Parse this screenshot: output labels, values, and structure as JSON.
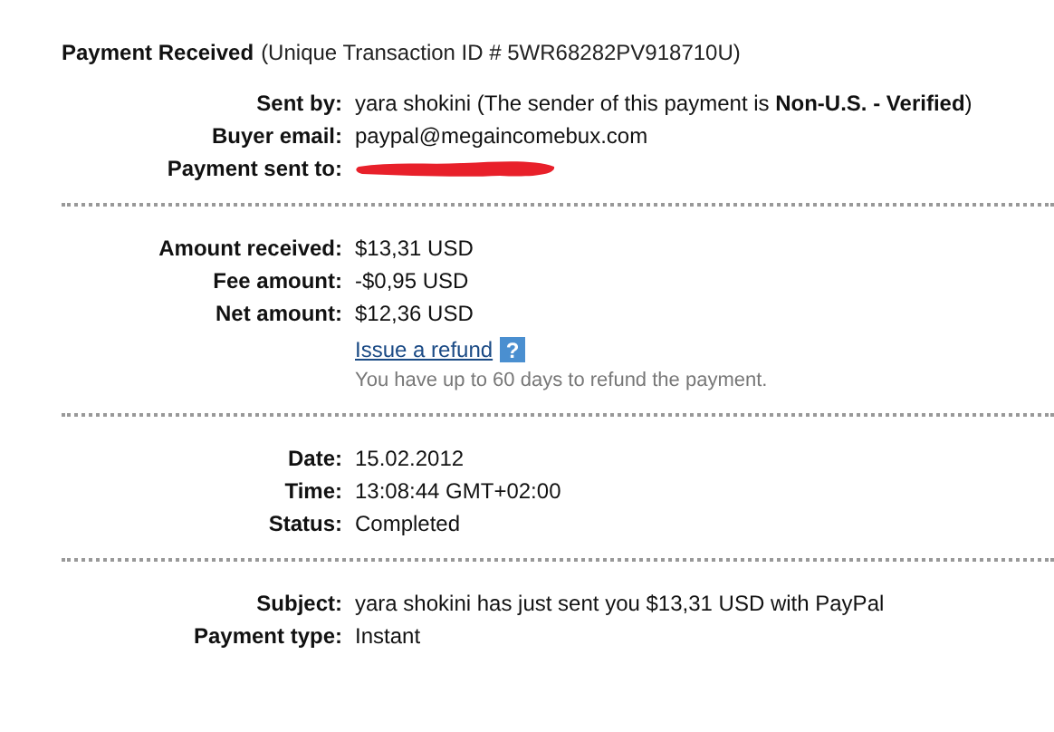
{
  "header": {
    "title": "Payment Received",
    "subtitle": "(Unique Transaction ID # 5WR68282PV918710U)"
  },
  "sections": [
    {
      "rows": [
        {
          "label": "Sent by:",
          "kind": "text",
          "value": "yara shokini (The sender of this payment is **Non-U.S. - Verified**)"
        },
        {
          "label": "Buyer email:",
          "kind": "text",
          "value": "paypal@megaincomebux.com"
        },
        {
          "label": "Payment sent to:",
          "kind": "redacted"
        }
      ]
    },
    {
      "rows": [
        {
          "label": "Amount received:",
          "kind": "text",
          "value": "$13,31 USD"
        },
        {
          "label": "Fee amount:",
          "kind": "text",
          "value": "-$0,95 USD"
        },
        {
          "label": "Net amount:",
          "kind": "text",
          "value": "$12,36 USD"
        },
        {
          "kind": "link",
          "value": "Issue a refund",
          "help": "?"
        },
        {
          "kind": "note",
          "value": "You have up to 60 days to refund the payment."
        }
      ]
    },
    {
      "rows": [
        {
          "label": "Date:",
          "kind": "text",
          "value": "15.02.2012"
        },
        {
          "label": "Time:",
          "kind": "text",
          "value": "13:08:44 GMT+02:00"
        },
        {
          "label": "Status:",
          "kind": "text",
          "value": "Completed"
        }
      ]
    },
    {
      "rows": [
        {
          "label": "Subject:",
          "kind": "text",
          "value": "yara shokini has just sent you $13,31 USD with PayPal"
        },
        {
          "label": "Payment type:",
          "kind": "text",
          "value": "Instant"
        }
      ]
    }
  ]
}
